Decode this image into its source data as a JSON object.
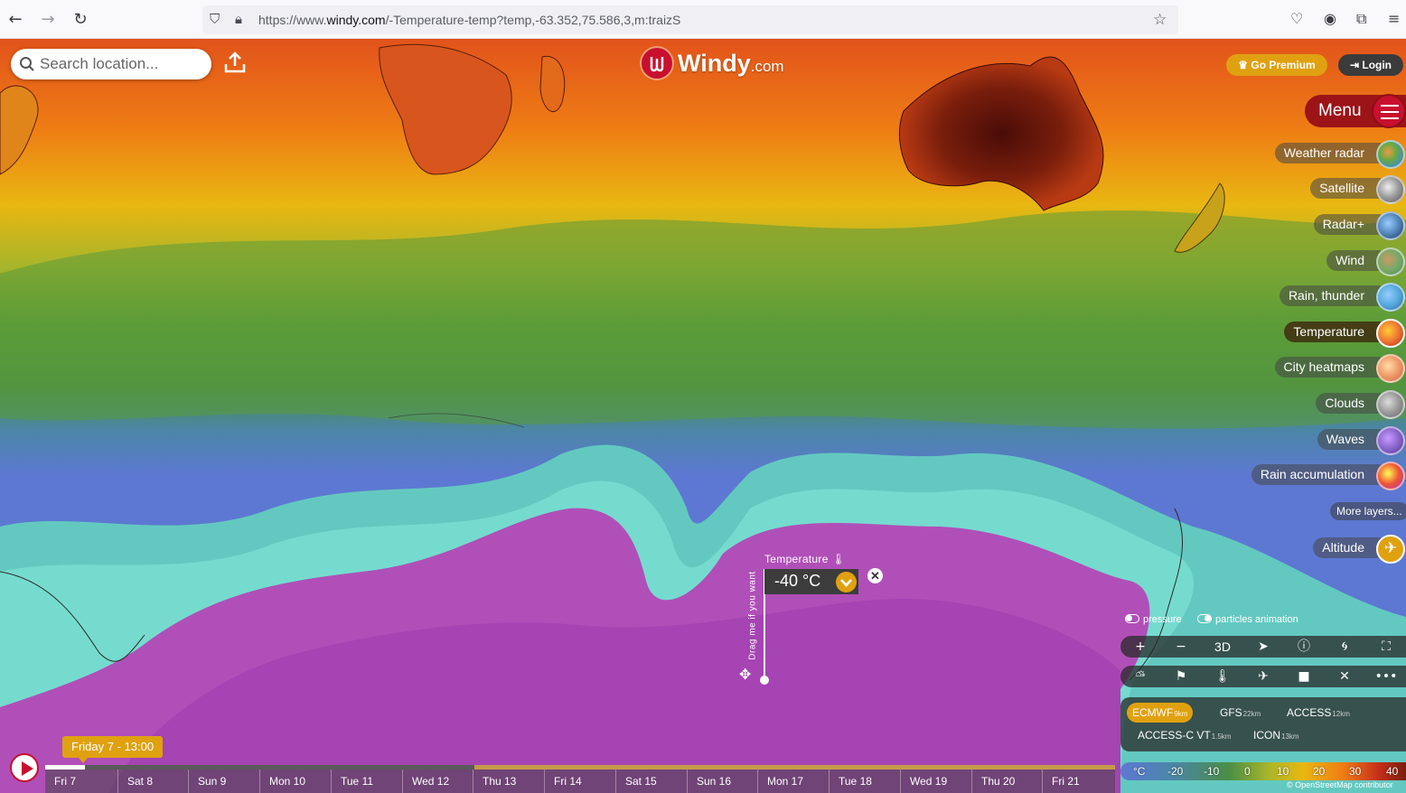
{
  "browser": {
    "url_prefix": "https://www.",
    "url_domain": "windy.com",
    "url_rest": "/-Temperature-temp?temp,-63.352,75.586,3,m:traizS"
  },
  "search": {
    "placeholder": "Search location..."
  },
  "logo": {
    "word": "Windy",
    "suffix": ".com"
  },
  "top_buttons": {
    "premium": "Go Premium",
    "login": "Login"
  },
  "menu": {
    "label": "Menu"
  },
  "layers": [
    {
      "label": "Weather radar",
      "active": false
    },
    {
      "label": "Satellite",
      "active": false
    },
    {
      "label": "Radar+",
      "active": false
    },
    {
      "label": "Wind",
      "active": false
    },
    {
      "label": "Rain, thunder",
      "active": false
    },
    {
      "label": "Temperature",
      "active": true
    },
    {
      "label": "City heatmaps",
      "active": false
    },
    {
      "label": "Clouds",
      "active": false
    },
    {
      "label": "Waves",
      "active": false
    },
    {
      "label": "Rain accumulation",
      "active": false
    }
  ],
  "more_layers": "More layers...",
  "altitude": "Altitude",
  "picker": {
    "title": "Temperature",
    "value": "-40 °C",
    "drag_hint": "Drag me if you want"
  },
  "switches": {
    "pressure": "pressure",
    "particles": "particles animation"
  },
  "controls": {
    "three_d": "3D"
  },
  "models": [
    {
      "name": "ECMWF",
      "res": "9km",
      "active": true
    },
    {
      "name": "GFS",
      "res": "22km",
      "active": false
    },
    {
      "name": "ACCESS",
      "res": "12km",
      "active": false
    },
    {
      "name": "ACCESS-C VT",
      "res": "1.5km",
      "active": false
    },
    {
      "name": "ICON",
      "res": "13km",
      "active": false
    }
  ],
  "legend": {
    "unit": "°C",
    "labels": [
      "-20",
      "-10",
      "0",
      "10",
      "20",
      "30",
      "40"
    ]
  },
  "attribution": "© OpenStreetMap contributor",
  "timeline": {
    "current": "Friday 7 - 13:00",
    "days": [
      "Fri 7",
      "Sat 8",
      "Sun 9",
      "Mon 10",
      "Tue 11",
      "Wed 12",
      "Thu 13",
      "Fri 14",
      "Sat 15",
      "Sun 16",
      "Mon 17",
      "Tue 18",
      "Wed 19",
      "Thu 20",
      "Fri 21"
    ]
  },
  "colors": {
    "brand_red": "#c8102e",
    "accent_gold": "#e0a110"
  }
}
